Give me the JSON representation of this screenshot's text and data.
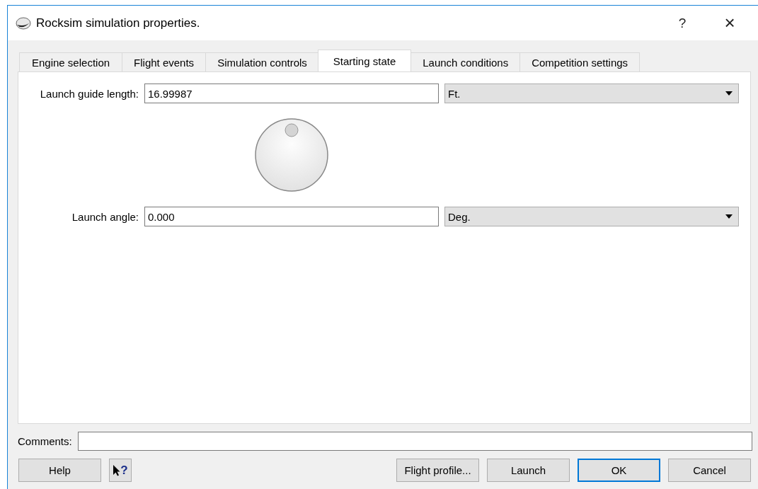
{
  "window": {
    "title": "Rocksim simulation properties.",
    "help_glyph": "?",
    "close_glyph": "×"
  },
  "tabs": [
    {
      "label": "Engine selection",
      "selected": false
    },
    {
      "label": "Flight events",
      "selected": false
    },
    {
      "label": "Simulation controls",
      "selected": false
    },
    {
      "label": "Starting state",
      "selected": true
    },
    {
      "label": "Launch conditions",
      "selected": false
    },
    {
      "label": "Competition settings",
      "selected": false
    }
  ],
  "launch_guide_length": {
    "label": "Launch guide length:",
    "value": "16.99987",
    "unit": "Ft."
  },
  "launch_angle": {
    "label": "Launch angle:",
    "value": "0.000",
    "unit": "Deg."
  },
  "comments": {
    "label": "Comments:"
  },
  "left_buttons": [
    {
      "kind": "text",
      "label": "Help"
    },
    {
      "kind": "whats_this",
      "label": "?"
    }
  ],
  "right_buttons": [
    {
      "label": "Flight profile...",
      "default": false
    },
    {
      "label": "Launch",
      "default": false
    },
    {
      "label": "OK",
      "default": true
    },
    {
      "label": "Cancel",
      "default": false
    }
  ]
}
